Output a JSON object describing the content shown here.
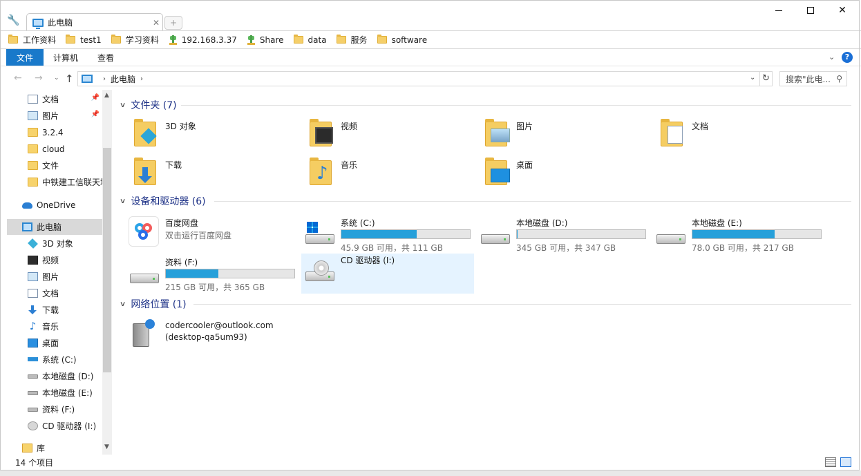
{
  "window": {
    "tab_title": "此电脑",
    "tab_close": "✕",
    "new_tab": "+",
    "minimize": "minimize",
    "maximize": "maximize",
    "close": "✕"
  },
  "bookmarks": [
    {
      "label": "工作资料",
      "icon": "folder-icon"
    },
    {
      "label": "test1",
      "icon": "folder-icon"
    },
    {
      "label": "学习资料",
      "icon": "folder-icon"
    },
    {
      "label": "192.168.3.37",
      "icon": "network-share-icon"
    },
    {
      "label": "Share",
      "icon": "network-share-icon"
    },
    {
      "label": "data",
      "icon": "folder-icon"
    },
    {
      "label": "服务",
      "icon": "folder-icon"
    },
    {
      "label": "software",
      "icon": "folder-icon"
    }
  ],
  "ribbon": {
    "tabs": [
      "文件",
      "计算机",
      "查看"
    ],
    "expand": "⌄",
    "help": "?"
  },
  "address": {
    "crumb": "此电脑",
    "search_placeholder": "搜索\"此电...",
    "refresh": "↻"
  },
  "nav": {
    "quick_access": [
      {
        "label": "文档",
        "icon": "documents-icon",
        "pinned": true
      },
      {
        "label": "图片",
        "icon": "pictures-icon",
        "pinned": true
      },
      {
        "label": "3.2.4",
        "icon": "folder-icon"
      },
      {
        "label": "cloud",
        "icon": "folder-icon"
      },
      {
        "label": "文件",
        "icon": "folder-icon"
      },
      {
        "label": "中铁建工信联天地",
        "icon": "folder-icon"
      }
    ],
    "onedrive": "OneDrive",
    "this_pc": "此电脑",
    "this_pc_children": [
      {
        "label": "3D 对象",
        "icon": "3d-objects-icon"
      },
      {
        "label": "视频",
        "icon": "videos-icon"
      },
      {
        "label": "图片",
        "icon": "pictures-icon"
      },
      {
        "label": "文档",
        "icon": "documents-icon"
      },
      {
        "label": "下载",
        "icon": "downloads-icon"
      },
      {
        "label": "音乐",
        "icon": "music-icon"
      },
      {
        "label": "桌面",
        "icon": "desktop-icon"
      },
      {
        "label": "系统 (C:)",
        "icon": "system-drive-icon"
      },
      {
        "label": "本地磁盘 (D:)",
        "icon": "drive-icon"
      },
      {
        "label": "本地磁盘 (E:)",
        "icon": "drive-icon"
      },
      {
        "label": "资料 (F:)",
        "icon": "drive-icon"
      },
      {
        "label": "CD 驱动器 (I:)",
        "icon": "cd-drive-icon"
      }
    ],
    "library": "库"
  },
  "groups": {
    "folders": "文件夹 (7)",
    "devices": "设备和驱动器 (6)",
    "network": "网络位置 (1)"
  },
  "folders": [
    {
      "label": "3D 对象",
      "icon": "3d-objects-folder-icon"
    },
    {
      "label": "视频",
      "icon": "videos-folder-icon"
    },
    {
      "label": "图片",
      "icon": "pictures-folder-icon"
    },
    {
      "label": "文档",
      "icon": "documents-folder-icon"
    },
    {
      "label": "下载",
      "icon": "downloads-folder-icon"
    },
    {
      "label": "音乐",
      "icon": "music-folder-icon"
    },
    {
      "label": "桌面",
      "icon": "desktop-folder-icon"
    }
  ],
  "devices": [
    {
      "name": "百度网盘",
      "sub": "双击运行百度网盘",
      "icon": "baidu-netdisk-icon"
    },
    {
      "name": "系统 (C:)",
      "info": "45.9 GB 可用，共 111 GB",
      "used_fraction": 0.586,
      "icon": "system-drive-icon"
    },
    {
      "name": "本地磁盘 (D:)",
      "info": "345 GB 可用，共 347 GB",
      "used_fraction": 0.006,
      "icon": "drive-icon"
    },
    {
      "name": "本地磁盘 (E:)",
      "info": "78.0 GB 可用，共 217 GB",
      "used_fraction": 0.641,
      "icon": "drive-icon"
    },
    {
      "name": "资料 (F:)",
      "info": "215 GB 可用，共 365 GB",
      "used_fraction": 0.411,
      "icon": "drive-icon"
    },
    {
      "name": "CD 驱动器 (I:)",
      "icon": "cd-drive-icon"
    }
  ],
  "network_location": {
    "line1": "codercooler@outlook.com",
    "line2": "(desktop-qa5um93)",
    "icon": "network-location-icon"
  },
  "status": {
    "count": "14 个项目"
  },
  "colors": {
    "accent": "#1979ca",
    "bar_fill": "#26a0da",
    "group_header": "#1e3287",
    "selected_tile": "#e5f3ff"
  }
}
